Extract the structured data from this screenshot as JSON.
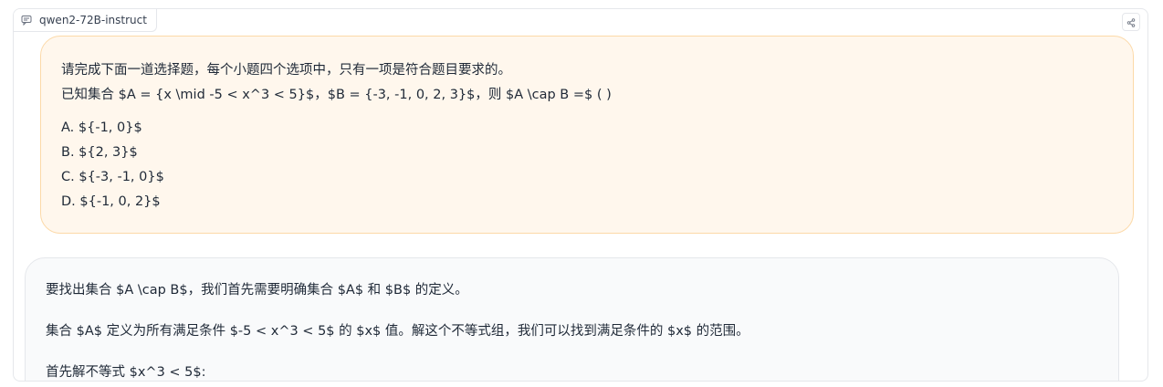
{
  "header": {
    "model_name": "qwen2-72B-instruct",
    "model_icon": "chat-bubble-icon",
    "share_icon": "share-icon"
  },
  "user_message": {
    "line1": "请完成下面一道选择题，每个小题四个选项中，只有一项是符合题目要求的。",
    "line2": "已知集合 $A = {x \\mid -5 < x^3 < 5}$，$B = {-3, -1, 0, 2, 3}$，则 $A \\cap B =$ ( )",
    "options": [
      "A. ${-1, 0}$",
      "B. ${2, 3}$",
      "C. ${-3, -1, 0}$",
      "D. ${-1, 0, 2}$"
    ]
  },
  "assistant_message": {
    "paragraphs": [
      "要找出集合 $A \\cap B$，我们首先需要明确集合 $A$ 和 $B$ 的定义。",
      "集合 $A$ 定义为所有满足条件 $-5 < x^3 < 5$ 的 $x$ 值。解这个不等式组，我们可以找到满足条件的 $x$ 的范围。",
      "首先解不等式 $x^3 < 5$:"
    ]
  },
  "colors": {
    "user_bubble_bg": "#fff7ed",
    "user_bubble_border": "#fcd9a8",
    "assistant_bubble_bg": "#f9fafb"
  }
}
